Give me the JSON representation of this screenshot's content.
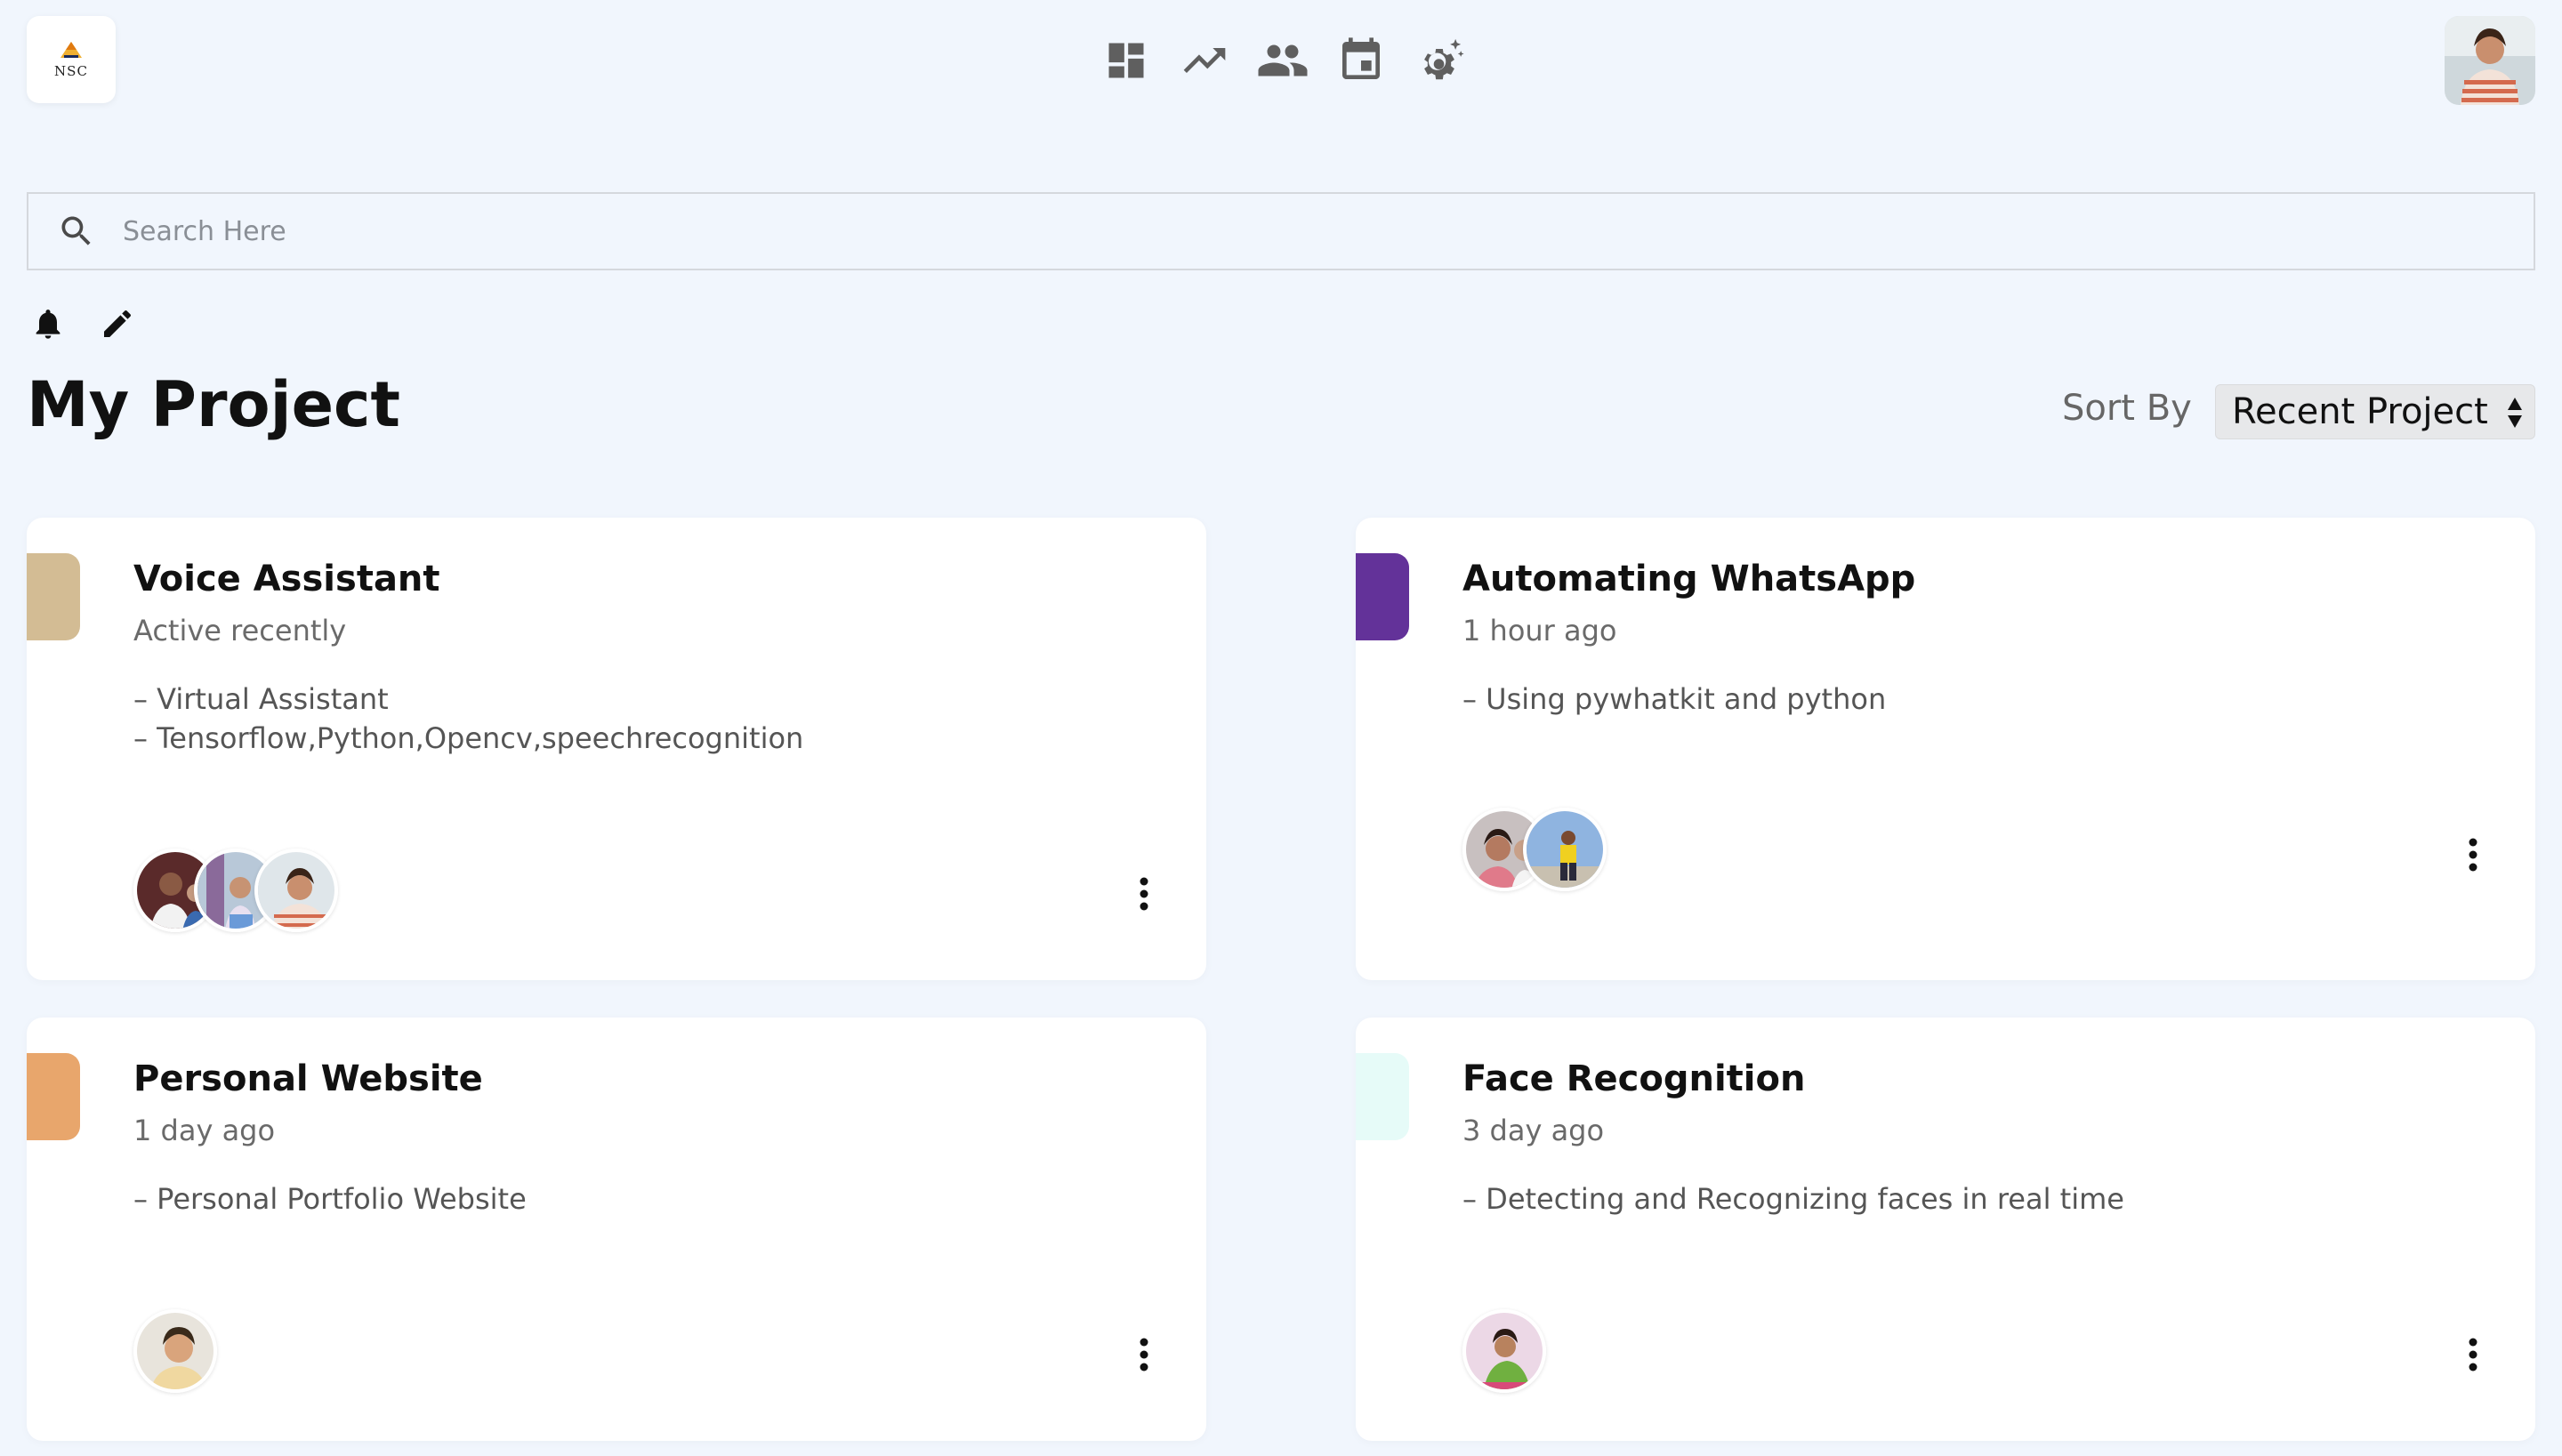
{
  "brand": {
    "logo_text": "NSC",
    "logo_icon": "nsc-logo-icon"
  },
  "nav": {
    "items": [
      {
        "name": "dashboard",
        "icon": "dashboard-icon"
      },
      {
        "name": "trending",
        "icon": "trending-up-icon"
      },
      {
        "name": "people",
        "icon": "people-icon"
      },
      {
        "name": "calendar",
        "icon": "calendar-icon"
      },
      {
        "name": "settings",
        "icon": "settings-sparkle-icon"
      }
    ]
  },
  "search": {
    "placeholder": "Search Here",
    "value": ""
  },
  "toolbar": {
    "notification_icon": "bell-icon",
    "edit_icon": "pencil-icon"
  },
  "page": {
    "title": "My Project"
  },
  "sort": {
    "label": "Sort By",
    "selected": "Recent Project"
  },
  "projects": [
    {
      "title": "Voice Assistant",
      "time": "Active recently",
      "lines": [
        "– Virtual Assistant",
        "– Tensorflow,Python,Opencv,speechrecognition"
      ],
      "accent": "#d3bc94",
      "members": 3
    },
    {
      "title": "Automating WhatsApp",
      "time": "1 hour ago",
      "lines": [
        "– Using pywhatkit and python"
      ],
      "accent": "#633299",
      "members": 2
    },
    {
      "title": "Personal Website",
      "time": "1 day ago",
      "lines": [
        "– Personal Portfolio Website"
      ],
      "accent": "#e8a66c",
      "members": 1
    },
    {
      "title": "Face Recognition",
      "time": "3 day ago",
      "lines": [
        "– Detecting and Recognizing faces in real time"
      ],
      "accent": "#e6fbf8",
      "members": 1
    }
  ],
  "colors": {
    "background": "#f1f6fd",
    "card": "#ffffff",
    "icon": "#5f5f5f"
  }
}
